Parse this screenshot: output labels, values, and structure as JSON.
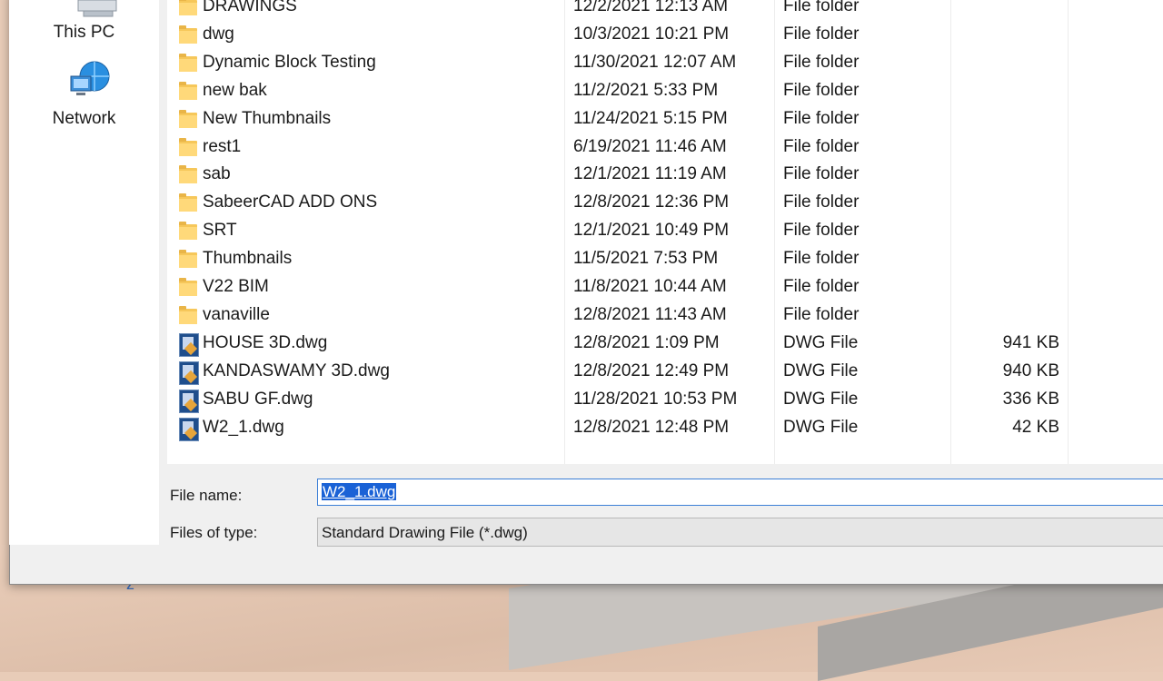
{
  "nav": {
    "this_pc": {
      "label": "This PC",
      "icon": "computer-icon"
    },
    "network": {
      "label": "Network",
      "icon": "network-icon"
    }
  },
  "files": [
    {
      "name": "DRAWINGS",
      "date": "12/2/2021 12:13 AM",
      "type": "File folder",
      "size": "",
      "icon": "folder-icon"
    },
    {
      "name": "dwg",
      "date": "10/3/2021 10:21 PM",
      "type": "File folder",
      "size": "",
      "icon": "folder-icon"
    },
    {
      "name": "Dynamic Block Testing",
      "date": "11/30/2021 12:07 AM",
      "type": "File folder",
      "size": "",
      "icon": "folder-icon"
    },
    {
      "name": "new bak",
      "date": "11/2/2021 5:33 PM",
      "type": "File folder",
      "size": "",
      "icon": "folder-icon"
    },
    {
      "name": "New Thumbnails",
      "date": "11/24/2021 5:15 PM",
      "type": "File folder",
      "size": "",
      "icon": "folder-icon"
    },
    {
      "name": "rest1",
      "date": "6/19/2021 11:46 AM",
      "type": "File folder",
      "size": "",
      "icon": "folder-icon"
    },
    {
      "name": "sab",
      "date": "12/1/2021 11:19 AM",
      "type": "File folder",
      "size": "",
      "icon": "folder-icon"
    },
    {
      "name": "SabeerCAD ADD ONS",
      "date": "12/8/2021 12:36 PM",
      "type": "File folder",
      "size": "",
      "icon": "folder-icon"
    },
    {
      "name": "SRT",
      "date": "12/1/2021 10:49 PM",
      "type": "File folder",
      "size": "",
      "icon": "folder-icon"
    },
    {
      "name": "Thumbnails",
      "date": "11/5/2021 7:53 PM",
      "type": "File folder",
      "size": "",
      "icon": "folder-icon"
    },
    {
      "name": "V22 BIM",
      "date": "11/8/2021 10:44 AM",
      "type": "File folder",
      "size": "",
      "icon": "folder-icon"
    },
    {
      "name": "vanaville",
      "date": "12/8/2021 11:43 AM",
      "type": "File folder",
      "size": "",
      "icon": "folder-icon"
    },
    {
      "name": "HOUSE 3D.dwg",
      "date": "12/8/2021 1:09 PM",
      "type": "DWG File",
      "size": "941 KB",
      "icon": "dwg-file-icon"
    },
    {
      "name": "KANDASWAMY 3D.dwg",
      "date": "12/8/2021 12:49 PM",
      "type": "DWG File",
      "size": "940 KB",
      "icon": "dwg-file-icon"
    },
    {
      "name": "SABU GF.dwg",
      "date": "11/28/2021 10:53 PM",
      "type": "DWG File",
      "size": "336 KB",
      "icon": "dwg-file-icon"
    },
    {
      "name": "W2_1.dwg",
      "date": "12/8/2021 12:48 PM",
      "type": "DWG File",
      "size": "42 KB",
      "icon": "dwg-file-icon"
    }
  ],
  "footer": {
    "file_name_label": "File name:",
    "file_name_value": "W2_1.dwg",
    "file_type_label": "Files of type:",
    "file_type_value": "Standard Drawing File (*.dwg)"
  },
  "background": {
    "mark": "z"
  },
  "colors": {
    "selection": "#1a62d6",
    "folder": "#ffd97a",
    "input_border": "#3c7fd6"
  }
}
